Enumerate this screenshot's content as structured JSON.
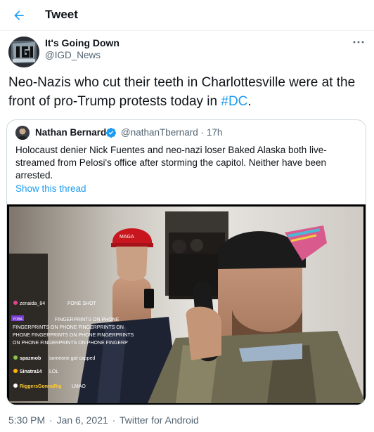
{
  "header": {
    "title": "Tweet"
  },
  "author": {
    "name": "It's Going Down",
    "handle": "@IGD_News"
  },
  "tweet": {
    "text_prefix": "Neo-Nazis who cut their teeth in Charlottesville were at the front of pro-Trump protests today in ",
    "hashtag": "#DC",
    "text_suffix": "."
  },
  "quote": {
    "name": "Nathan Bernard",
    "handle": "@nathanTbernard",
    "separator": "·",
    "time": "17h",
    "text": "Holocaust denier Nick Fuentes and neo-nazi loser Baked Alaska both live-streamed from Pelosi's office after storming the capitol. Neither have been arrested.",
    "show_thread": "Show this thread"
  },
  "media": {
    "overlay_lines": [
      "FONE SHOT",
      "FINGERPRINTS ON PHONE",
      "FINGERPRINTS ON PHONE FINGERPRINTS ON",
      "PHONE FINGERPRINTS ON PHONE FINGERPRINTS",
      "ON PHONE FINGERPRINTS ON PHONE FINGERP"
    ],
    "chat": [
      {
        "user": "zenaida_84",
        "msg": ""
      },
      {
        "user": "spazmob",
        "msg": "someone got capped"
      },
      {
        "user": "Sinatra14",
        "msg": "LOL"
      },
      {
        "user": "RiggersGonnaRig",
        "msg": "LMAO"
      }
    ],
    "badge": "YOBA"
  },
  "footer": {
    "time": "5:30 PM",
    "sep1": "·",
    "date": "Jan 6, 2021",
    "sep2": "·",
    "app": "Twitter for Android"
  },
  "colors": {
    "accent": "#1d9bf0",
    "text": "#0f1419",
    "muted": "#536471",
    "border": "#cfd9de"
  },
  "icons": {
    "back": "arrow-left-icon",
    "more": "more-horizontal-icon",
    "verified": "verified-badge-icon"
  }
}
